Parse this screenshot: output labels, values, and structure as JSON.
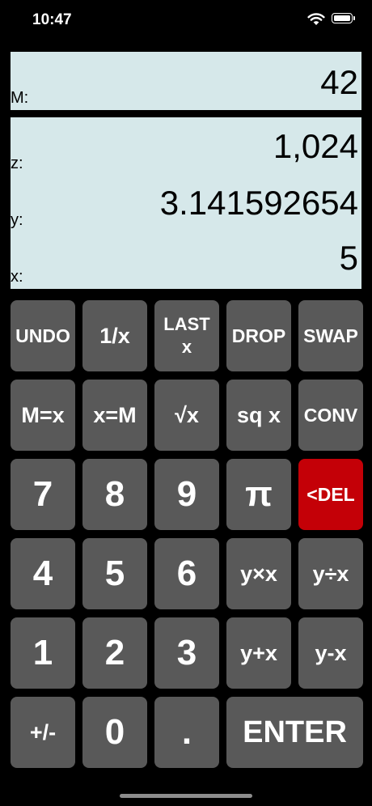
{
  "status": {
    "time": "10:47"
  },
  "memory": {
    "label": "M:",
    "value": "42"
  },
  "stack": [
    {
      "label": "z:",
      "value": "1,024"
    },
    {
      "label": "y:",
      "value": "3.141592654"
    },
    {
      "label": "x:",
      "value": "5"
    }
  ],
  "keys": {
    "undo": "UNDO",
    "reciprocal": "1/x",
    "last_x_line1": "LAST",
    "last_x_line2": "x",
    "drop": "DROP",
    "swap": "SWAP",
    "m_eq_x": "M=x",
    "x_eq_m": "x=M",
    "sqrt": "√x",
    "sq": "sq x",
    "conv": "CONV",
    "n7": "7",
    "n8": "8",
    "n9": "9",
    "pi": "π",
    "del": "<DEL",
    "n4": "4",
    "n5": "5",
    "n6": "6",
    "mul": "y×x",
    "div": "y÷x",
    "n1": "1",
    "n2": "2",
    "n3": "3",
    "add": "y+x",
    "sub": "y-x",
    "sign": "+/-",
    "n0": "0",
    "dot": ".",
    "enter": "ENTER"
  },
  "colors": {
    "panel": "#d6e8ea",
    "key": "#595959",
    "delete_key": "#c40007"
  },
  "icons": [
    "wifi-icon",
    "battery-icon"
  ]
}
